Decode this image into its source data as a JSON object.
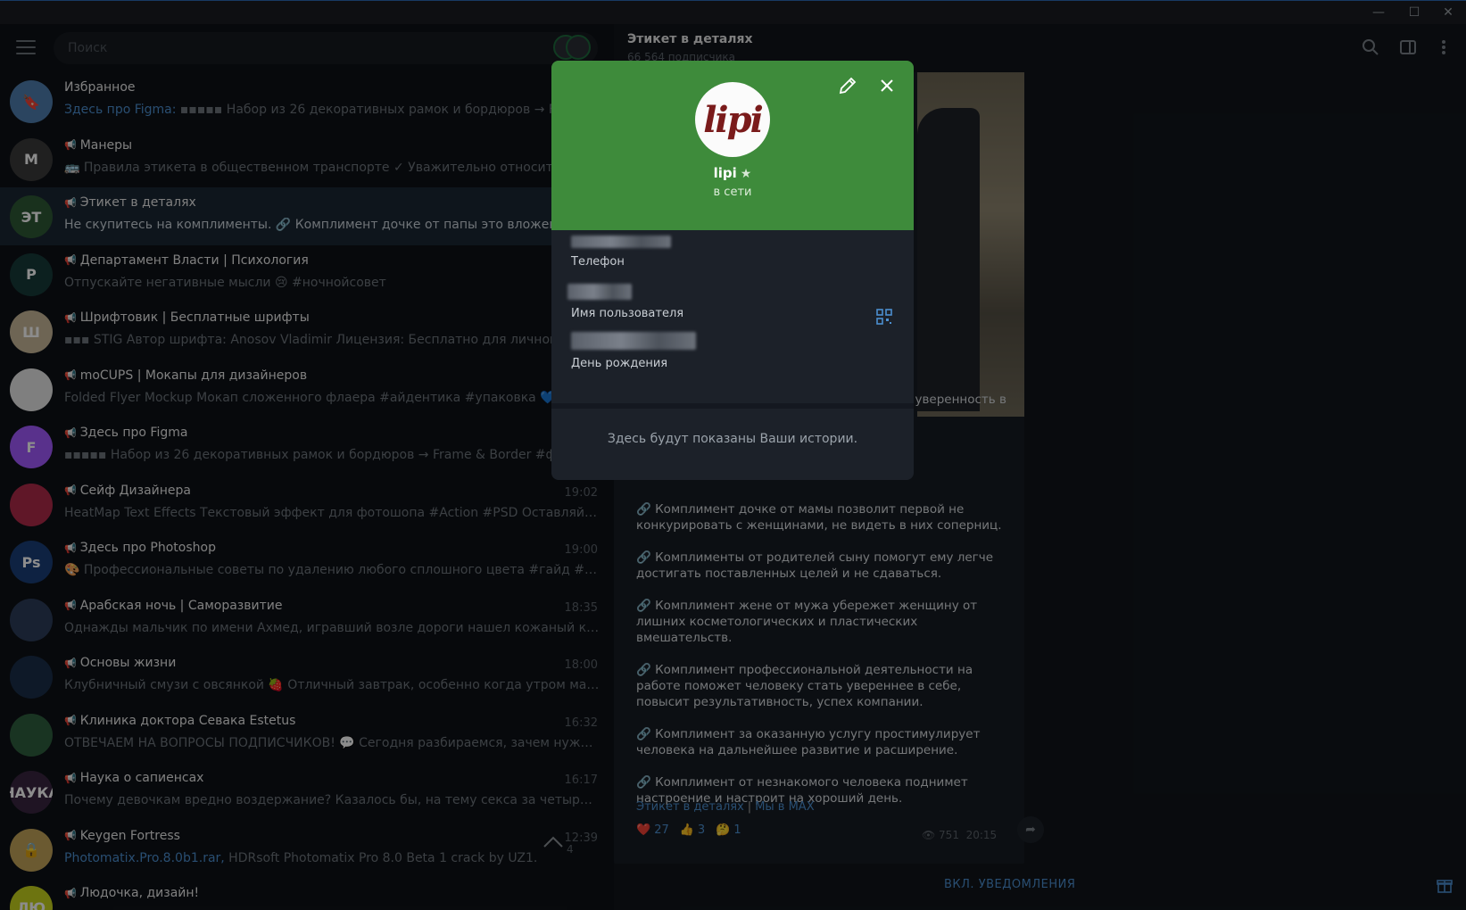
{
  "window": {
    "minimize": "—",
    "maximize": "☐",
    "close": "✕"
  },
  "sidebar": {
    "search_placeholder": "Поиск",
    "chats": [
      {
        "name": "Избранное",
        "channel": false,
        "time": "",
        "preview_accent": "Здесь про Figma:",
        "preview": " ▪▪▪▪▪ Набор из 26 декоративных рамок и бордюров → Frame & Border",
        "avatar_color": "#4f7fb0",
        "avatar_text": "🔖"
      },
      {
        "name": "Манеры",
        "channel": true,
        "time": "",
        "preview_accent": "",
        "preview": "🚌 Правила этикета в общественном транспорте ✓ Уважительно относитесь к другим",
        "avatar_color": "#3b3b3b",
        "avatar_text": "M"
      },
      {
        "name": "Этикет в деталях",
        "channel": true,
        "time": "",
        "preview_accent": "",
        "preview": "Не скупитесь на комплименты. 🔗 Комплимент дочке от папы это вложение в её",
        "avatar_color": "#2e5a36",
        "avatar_text": "ЭТ"
      },
      {
        "name": "Департамент Власти | Психология",
        "channel": true,
        "time": "",
        "preview_accent": "",
        "preview": "Отпускайте негативные мысли 😢 #ночнойсовет",
        "avatar_color": "#173b3a",
        "avatar_text": "P"
      },
      {
        "name": "Шрифтовик | Бесплатные шрифты",
        "channel": true,
        "time": "",
        "preview_accent": "",
        "preview": "▪▪▪ STIG  Автор шрифта: Anosov Vladimir Лицензия: Бесплатно для личного и коммерческого",
        "avatar_color": "#c9b99a",
        "avatar_text": "Ш"
      },
      {
        "name": "moCUPS | Мокапы для дизайнеров",
        "channel": true,
        "time": "",
        "preview_accent": "",
        "preview": "Folded Flyer Mockup  Мокап сложенного флаера  #айдентика #упаковка 💙",
        "avatar_color": "#e8e8e8",
        "avatar_text": ""
      },
      {
        "name": "Здесь про Figma",
        "channel": true,
        "time": "",
        "preview_accent": "",
        "preview": "▪▪▪▪▪ Набор из 26 декоративных рамок и бордюров → Frame & Border  #фигма",
        "avatar_color": "#a259ff",
        "avatar_text": "F"
      },
      {
        "name": "Сейф Дизайнера",
        "channel": true,
        "time": "19:02",
        "preview_accent": "",
        "preview": "HeatMap Text Effects  Текстовый эффект для фотошопа  #Action #PSD  Оставляйте❤️ ре...",
        "avatar_color": "#b02a4a",
        "avatar_text": ""
      },
      {
        "name": "Здесь про Photoshop",
        "channel": true,
        "time": "19:00",
        "preview_accent": "",
        "preview": "🎨 Профессиональные советы по удалению любого сплошного цвета  #гайд #фотошоп...",
        "avatar_color": "#1b3f78",
        "avatar_text": "Ps"
      },
      {
        "name": "Арабская ночь | Саморазвитие",
        "channel": true,
        "time": "18:35",
        "preview_accent": "",
        "preview": "Однажды мальчик по имени Ахмед, игравший возле дороги нашел кожаный кошелек, ...",
        "avatar_color": "#2d3d5a",
        "avatar_text": ""
      },
      {
        "name": "Основы жизни",
        "channel": true,
        "time": "18:00",
        "preview_accent": "",
        "preview": "Клубничный смузи с овсянкой 🍓 Отличный завтрак, особенно когда утром мало вре...",
        "avatar_color": "#1a2f4a",
        "avatar_text": ""
      },
      {
        "name": "Клиника доктора Севака Estetus",
        "channel": true,
        "time": "16:32",
        "preview_accent": "",
        "preview": "ОТВЕЧАЕМ НА ВОПРОСЫ ПОДПИСЧИКОВ! 💬 Сегодня разбираемся, зачем нужен ирри...",
        "avatar_color": "#2f5f3e",
        "avatar_text": ""
      },
      {
        "name": "Наука о сапиенсах",
        "channel": true,
        "time": "16:17",
        "preview_accent": "",
        "preview": "Почему девочкам вредно воздержание? Казалось бы, на тему секса за четыре с лишним г...",
        "avatar_color": "#3a2540",
        "avatar_text": "НАУКА"
      },
      {
        "name": "Keygen Fortress",
        "channel": true,
        "time": "12:39",
        "preview_accent": "Photomatix.Pro.8.0b1.rar,",
        "preview": " HDRsoft Photomatix Pro 8.0 Beta 1 crack by UZ1.",
        "avatar_color": "#c4a55a",
        "avatar_text": "🔒"
      },
      {
        "name": "Людочка, дизайн!",
        "channel": true,
        "time": "",
        "preview_accent": "",
        "preview": "",
        "avatar_color": "#c6d41e",
        "avatar_text": "ЛЮ"
      }
    ]
  },
  "chat": {
    "title": "Этикет в деталях",
    "subscribers": "66 564 подписчика",
    "top_line": "её уверенность в",
    "messages": [
      "🔗 Комплимент дочке от мамы позволит первой не конкурировать с женщинами, не видеть в них соперниц.",
      "🔗 Комплименты от родителей сыну помогут ему легче достигать поставленных целей и не сдаваться.",
      "🔗 Комплимент жене от мужа убережет женщину от лишних косметологических и пластических вмешательств.",
      "🔗 Комплимент профессиональной деятельности на работе поможет человеку стать увереннее в себе, повысит результативность, успех компании.",
      "🔗 Комплимент за оказанную услугу простимулирует человека на дальнейшее развитие и расширение.",
      "🔗 Комплимент от незнакомого человека поднимет настроение и настроит на хороший день."
    ],
    "link1": "Этикет в деталях",
    "link_sep": "|",
    "link2": "Мы в MAX",
    "reactions": [
      {
        "emoji": "❤️",
        "count": "27"
      },
      {
        "emoji": "👍",
        "count": "3"
      },
      {
        "emoji": "🤔",
        "count": "1"
      }
    ],
    "views": "👁 751",
    "time": "20:15",
    "notifications_button": "ВКЛ. УВЕДОМЛЕНИЯ",
    "scroll_badge": "4"
  },
  "profile": {
    "avatar_text": "lipi",
    "name": "lipi",
    "status": "в сети",
    "phone_label": "Телефон",
    "username_label": "Имя пользователя",
    "birthday_label": "День рождения",
    "stories_text": "Здесь будут показаны Ваши истории."
  },
  "colors": {
    "accent": "#4c8fd0",
    "profile_header": "#3e8b3b",
    "active_chat": "#1b2733"
  }
}
